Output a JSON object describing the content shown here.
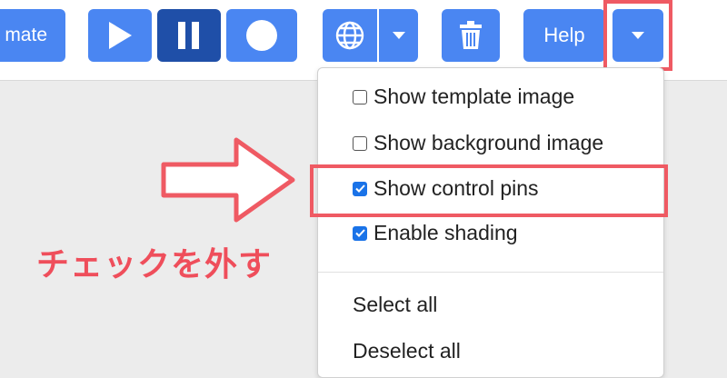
{
  "toolbar": {
    "animate_label": "mate",
    "help_label": "Help",
    "icons": {
      "play": "play-icon",
      "pause": "pause-icon",
      "record": "record-icon",
      "globe": "globe-icon",
      "caret": "caret-down-icon",
      "trash": "trash-icon"
    }
  },
  "menu": {
    "items": [
      {
        "label": "Show template image",
        "checked": false
      },
      {
        "label": "Show background image",
        "checked": false
      },
      {
        "label": "Show control pins",
        "checked": true
      },
      {
        "label": "Enable shading",
        "checked": true
      }
    ],
    "actions": [
      {
        "label": "Select all"
      },
      {
        "label": "Deselect all"
      }
    ]
  },
  "annotation": {
    "text": "チェックを外す",
    "color": "#ef4e5b"
  },
  "colors": {
    "button_blue": "#4a86f2",
    "button_dark": "#1f4fa8",
    "highlight": "#ef5a63",
    "checkbox_checked": "#1a73e8"
  }
}
